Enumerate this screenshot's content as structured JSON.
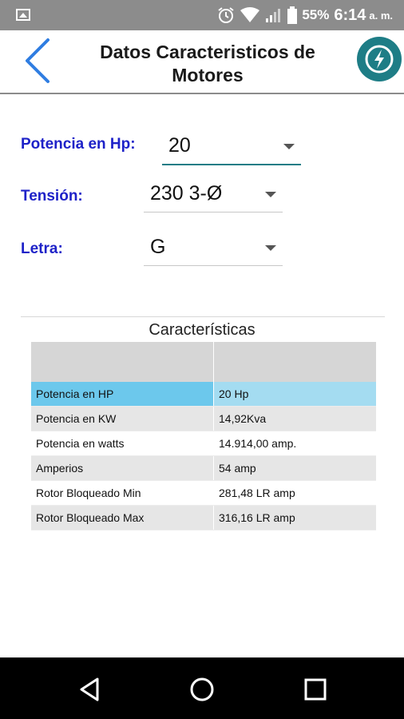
{
  "status_bar": {
    "battery": "55%",
    "time": "6:14",
    "ampm": "a. m."
  },
  "app_bar": {
    "title": "Datos Caracteristicos de Motores"
  },
  "form": {
    "potencia_label": "Potencia en Hp:",
    "potencia_value": "20",
    "tension_label": "Tensión:",
    "tension_value": "230  3-Ø",
    "letra_label": "Letra:",
    "letra_value": "G"
  },
  "table": {
    "title": "Características",
    "rows": [
      {
        "label": "Potencia en HP",
        "value": "20 Hp"
      },
      {
        "label": "Potencia en KW",
        "value": "14,92Kva"
      },
      {
        "label": "Potencia en watts",
        "value": "14.914,00 amp."
      },
      {
        "label": "Amperios",
        "value": "54 amp"
      },
      {
        "label": "Rotor Bloqueado Min",
        "value": "281,48 LR amp"
      },
      {
        "label": "Rotor Bloqueado Max",
        "value": "316,16 LR amp"
      }
    ]
  },
  "colors": {
    "accent": "#1e7d86",
    "label_blue": "#1e22c8",
    "back_arrow": "#2f7de1",
    "selected_row": "#6cc8ec"
  }
}
